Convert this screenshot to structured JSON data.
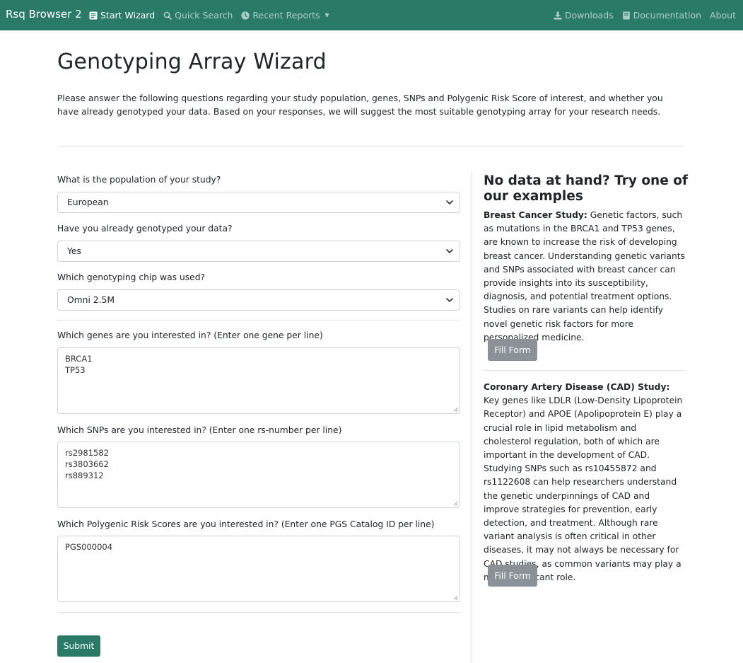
{
  "navbar": {
    "brand": "Rsq Browser 2",
    "left_links": [
      {
        "label": "Start Wizard",
        "icon": "form-icon"
      },
      {
        "label": "Quick Search",
        "icon": "search-icon"
      },
      {
        "label": "Recent Reports",
        "icon": "clock-icon"
      }
    ],
    "right_links": [
      {
        "label": "Downloads",
        "icon": "download-icon"
      },
      {
        "label": "Documentation",
        "icon": "book-icon"
      },
      {
        "label": "About"
      }
    ],
    "colors": {
      "background": "#2a7a68"
    }
  },
  "page": {
    "title": "Genotyping Array Wizard",
    "intro": "Please answer the following questions regarding your study population, genes, SNPs and Polygenic Risk Score of interest, and whether you have already genotyped your data. Based on your responses, we will suggest the most suitable genotyping array for your research needs."
  },
  "form": {
    "population": {
      "label": "What is the population of your study?",
      "value": "European"
    },
    "genotyped": {
      "label": "Have you already genotyped your data?",
      "value": "Yes"
    },
    "chip": {
      "label": "Which genotyping chip was used?",
      "value": "Omni 2.5M"
    },
    "genes": {
      "label": "Which genes are you interested in? (Enter one gene per line)",
      "lines": [
        "BRCA1",
        "TP53"
      ]
    },
    "snps": {
      "label": "Which SNPs are you interested in? (Enter one rs-number per line)",
      "lines": [
        "rs2981582",
        "rs3803662",
        "rs889312"
      ]
    },
    "pgs": {
      "label": "Which Polygenic Risk Scores are you interested in? (Enter one PGS Catalog ID per line)",
      "lines": [
        "PGS000004"
      ]
    },
    "submit_label": "Submit"
  },
  "sidebar": {
    "title": "No data at hand? Try one of our examples",
    "examples": [
      {
        "title": "Breast Cancer Study:",
        "text": " Genetic factors, such as mutations in the BRCA1 and TP53 genes, are known to increase the risk of developing breast cancer. Understanding genetic variants and SNPs associated with breast cancer can provide insights into its susceptibility, diagnosis, and potential treatment options. Studies on rare variants can help identify novel genetic risk factors for more personalized medicine.",
        "button": "Fill Form"
      },
      {
        "title": "Coronary Artery Disease (CAD) Study:",
        "text": " Key genes like LDLR (Low-Density Lipoprotein Receptor) and APOE (Apolipoprotein E) play a crucial role in lipid metabolism and cholesterol regulation, both of which are important in the development of CAD. Studying SNPs such as rs10455872 and rs1122608 can help researchers understand the genetic underpinnings of CAD and improve strategies for prevention, early detection, and treatment. Although rare variant analysis is often critical in other diseases, it may not always be necessary for CAD studies, as common variants may play a more significant role.",
        "button": "Fill Form"
      }
    ]
  }
}
